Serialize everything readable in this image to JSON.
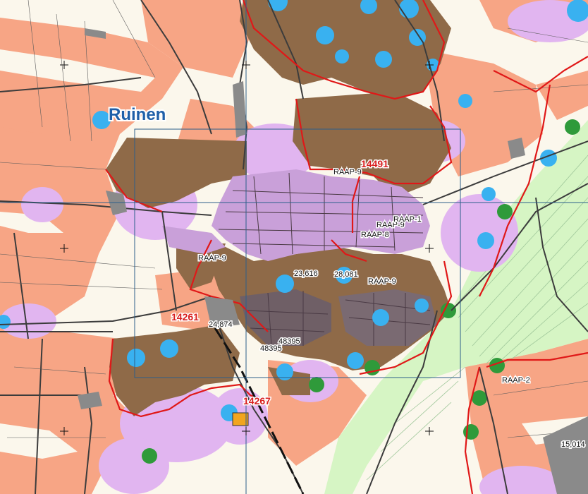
{
  "place_name": "Ruinen",
  "zone_codes": [
    "14491",
    "14261",
    "14267"
  ],
  "raap_labels": [
    "RAAP-9",
    "RAAP-9",
    "RAAP-9",
    "RAAP-9",
    "RAAP-8",
    "RAAP-1",
    "RAAP-2"
  ],
  "numbers": [
    "23,616",
    "28,081",
    "24,874",
    "48395",
    "48395",
    "15,014"
  ],
  "legend_colors": {
    "arable": "#f7a585",
    "brown_area": "#8f6a48",
    "buffer": "#e1b5f0",
    "grassland": "#d6f5c4",
    "water_point": "#39b1f0",
    "green_point": "#2f9a3a",
    "boundary": "#e01818",
    "built": "#c9a0d9",
    "frame": "#2c5f8a"
  }
}
